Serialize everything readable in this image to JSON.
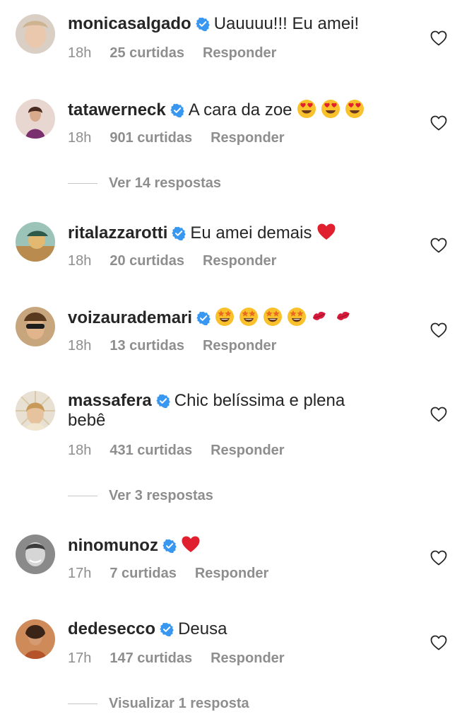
{
  "comments": [
    {
      "username": "monicasalgado",
      "text": "Uauuuu!!! Eu amei!",
      "emojis": [],
      "time": "18h",
      "likes": "25 curtidas",
      "reply": "Responder"
    },
    {
      "username": "tatawerneck",
      "text": "A cara da zoe",
      "emojis": [
        "heart-eyes-emoji",
        "heart-eyes-emoji",
        "heart-eyes-emoji"
      ],
      "time": "18h",
      "likes": "901 curtidas",
      "reply": "Responder",
      "view_replies": "Ver 14 respostas"
    },
    {
      "username": "ritalazzarotti",
      "text": "Eu amei demais",
      "emojis": [
        "red-heart-emoji"
      ],
      "time": "18h",
      "likes": "20 curtidas",
      "reply": "Responder"
    },
    {
      "username": "voizaurademari",
      "text": "",
      "emojis": [
        "star-struck-emoji",
        "star-struck-emoji",
        "star-struck-emoji",
        "star-struck-emoji",
        "kiss-mark-emoji",
        "kiss-mark-emoji"
      ],
      "time": "18h",
      "likes": "13 curtidas",
      "reply": "Responder"
    },
    {
      "username": "massafera",
      "text": "Chic belíssima e plena",
      "text2": "bebê",
      "emojis": [],
      "time": "18h",
      "likes": "431 curtidas",
      "reply": "Responder",
      "view_replies": "Ver 3 respostas"
    },
    {
      "username": "ninomunoz",
      "text": "",
      "emojis": [
        "red-heart-emoji"
      ],
      "time": "17h",
      "likes": "7 curtidas",
      "reply": "Responder"
    },
    {
      "username": "dedesecco",
      "text": "Deusa",
      "emojis": [],
      "time": "17h",
      "likes": "147 curtidas",
      "reply": "Responder",
      "view_replies": "Visualizar 1 resposta"
    }
  ],
  "colors": {
    "verified": "#3897f0",
    "meta": "#8e8e8e",
    "text": "#262626",
    "heart_emoji": "#e0202f"
  }
}
